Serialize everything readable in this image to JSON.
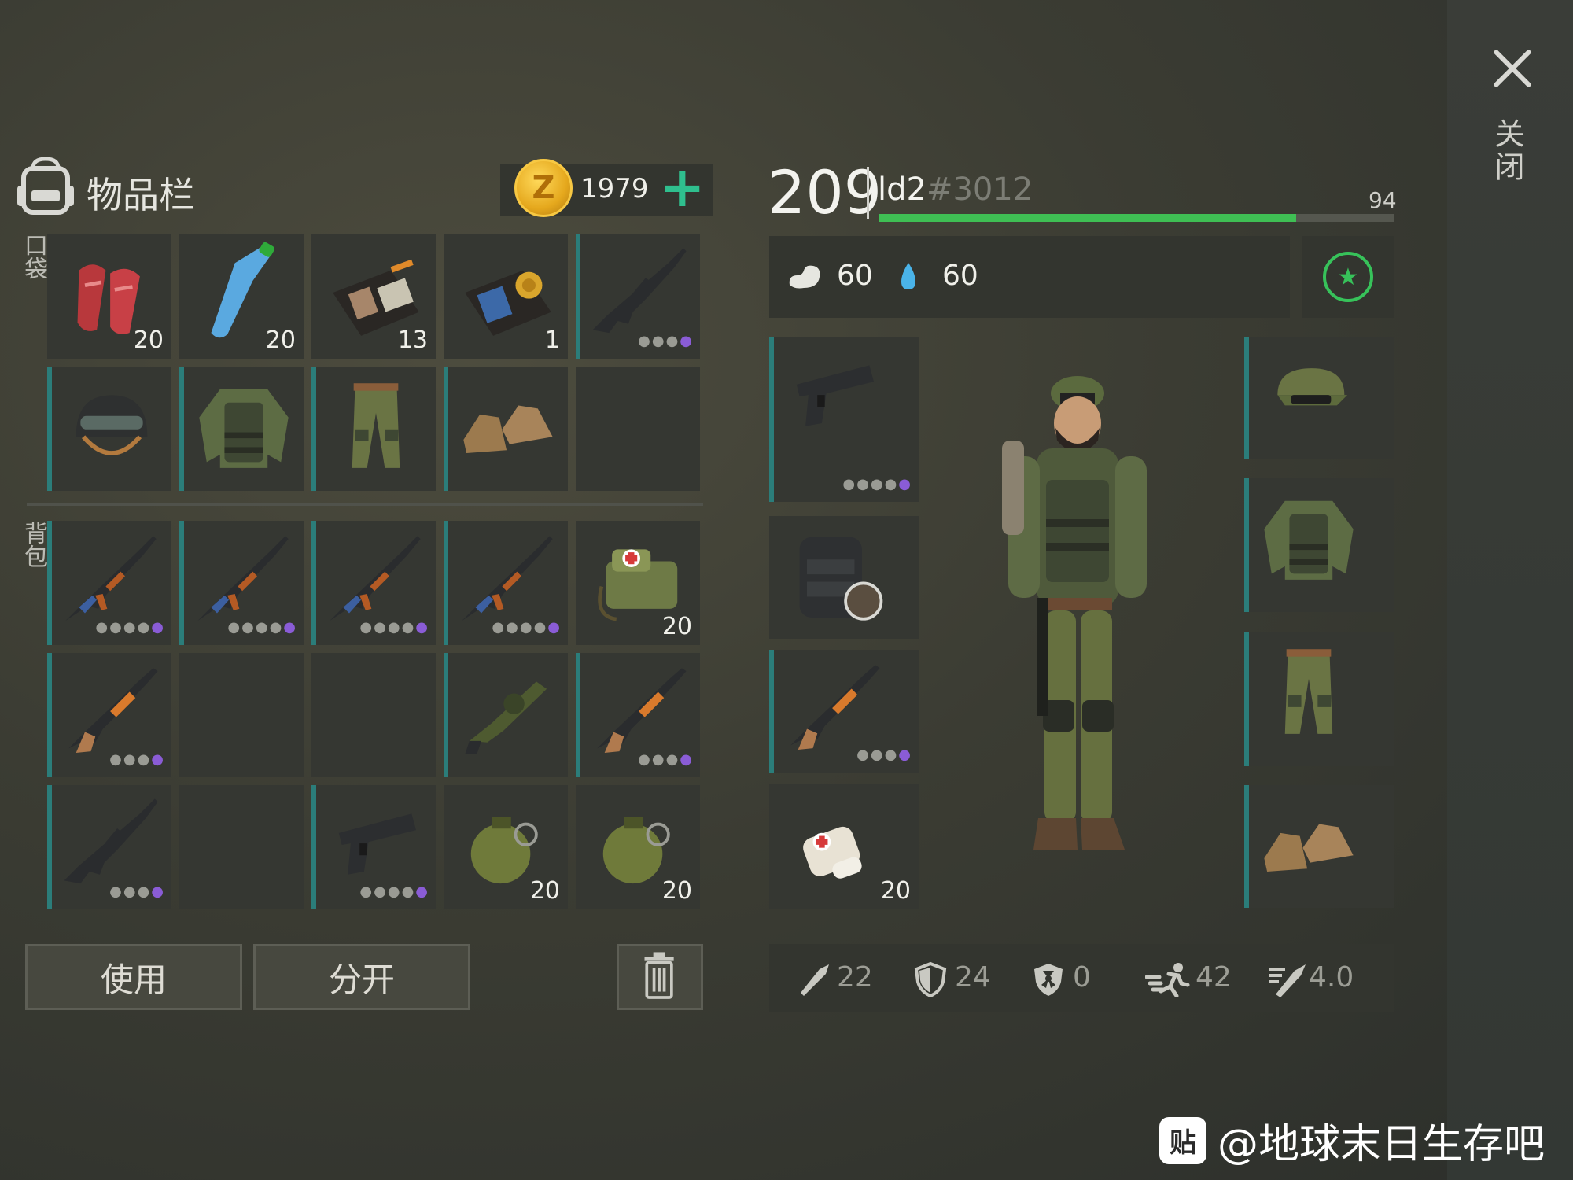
{
  "close": {
    "label": "关闭"
  },
  "inventory": {
    "title": "物品栏",
    "currency": {
      "value": "1979",
      "add_label": "+",
      "coin_symbol": "Z"
    },
    "pocket_label": "口袋",
    "backpack_label": "背包",
    "pockets": [
      {
        "name": "raw-meat",
        "qty": "20"
      },
      {
        "name": "water-bottle",
        "qty": "20"
      },
      {
        "name": "patrol-officer-id",
        "qty": "13"
      },
      {
        "name": "police-badge-wallet",
        "qty": "1"
      },
      {
        "name": "m16-rifle",
        "dots": "●●●●"
      },
      {
        "name": "military-helmet"
      },
      {
        "name": "camo-jacket"
      },
      {
        "name": "camo-pants"
      },
      {
        "name": "military-boots"
      },
      {
        "name": "empty"
      }
    ],
    "backpack": [
      {
        "name": "ak47-rifle",
        "dots": "●●●●●"
      },
      {
        "name": "ak47-rifle",
        "dots": "●●●●●"
      },
      {
        "name": "ak47-rifle",
        "dots": "●●●●●"
      },
      {
        "name": "ak47-rifle",
        "dots": "●●●●●"
      },
      {
        "name": "medkit-bag",
        "qty": "20"
      },
      {
        "name": "shotgun",
        "dots": "●●●●"
      },
      {
        "name": "empty"
      },
      {
        "name": "empty"
      },
      {
        "name": "grenade-launcher"
      },
      {
        "name": "shotgun",
        "dots": "●●●●"
      },
      {
        "name": "m16-rifle",
        "dots": "●●●●"
      },
      {
        "name": "empty"
      },
      {
        "name": "pistol",
        "dots": "●●●●●"
      },
      {
        "name": "frag-grenade",
        "qty": "20"
      },
      {
        "name": "frag-grenade",
        "qty": "20"
      }
    ],
    "use_label": "使用",
    "split_label": "分开"
  },
  "character": {
    "level": "209",
    "name": "ld2",
    "tag": "#3012",
    "xp_value": "94",
    "xp_fraction": 0.81,
    "hunger": "60",
    "thirst": "60",
    "equipment_left": [
      {
        "name": "pistol",
        "dots": "●●●●●"
      },
      {
        "name": "tactical-backpack"
      },
      {
        "name": "shotgun",
        "dots": "●●●●"
      },
      {
        "name": "bandage",
        "qty": "20"
      }
    ],
    "equipment_right": [
      {
        "name": "camo-cap"
      },
      {
        "name": "camo-jacket"
      },
      {
        "name": "camo-pants"
      },
      {
        "name": "military-boots"
      }
    ],
    "stats": {
      "attack": "22",
      "defense": "24",
      "radiation": "0",
      "speed": "42",
      "attack_speed": "4.0"
    }
  },
  "watermark": {
    "logo": "贴",
    "text": "@地球末日生存吧"
  },
  "colors": {
    "accent": "#2fbf8e",
    "xp": "#3fbf54",
    "slot_border": "#2b7d7a",
    "dots_gray": "#9a9b94",
    "dots_purple": "#8a5cd6",
    "dots_blue": "#5b7fe0"
  }
}
